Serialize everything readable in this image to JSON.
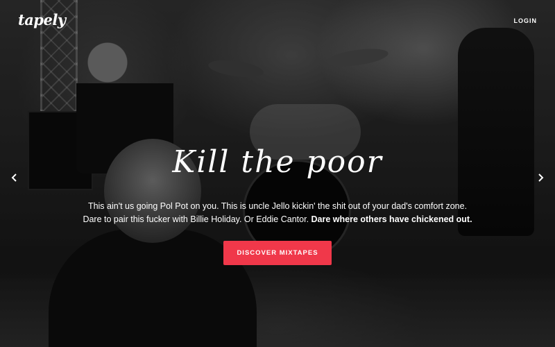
{
  "header": {
    "logo_text": "tapely",
    "login_label": "LOGIN"
  },
  "carousel": {
    "prev_icon": "chevron-left-icon",
    "next_icon": "chevron-right-icon"
  },
  "hero": {
    "headline": "Kill the poor",
    "tagline_line1": "This ain't us going Pol Pot on you. This is uncle Jello kickin' the shit out of your dad's comfort zone.",
    "tagline_line2_regular": "Dare to pair this fucker with Billie Holiday. Or Eddie Cantor. ",
    "tagline_line2_bold": "Dare where others have chickened out.",
    "cta_label": "DISCOVER MIXTAPES"
  },
  "colors": {
    "accent": "#f0384a",
    "text": "#ffffff"
  }
}
